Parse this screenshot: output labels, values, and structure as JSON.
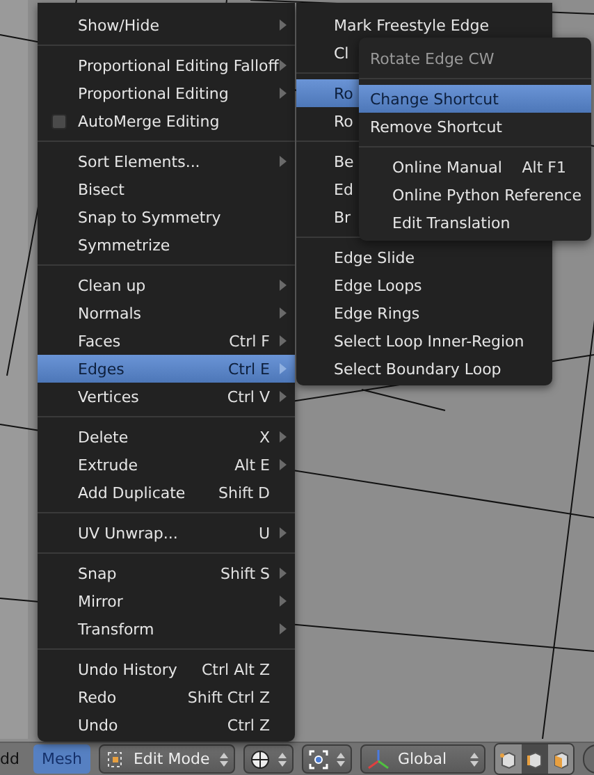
{
  "main_menu": {
    "items": [
      {
        "kind": "submenu",
        "label": "Show/Hide",
        "selected": false
      },
      {
        "kind": "separator"
      },
      {
        "kind": "submenu",
        "label": "Proportional Editing Falloff",
        "selected": false
      },
      {
        "kind": "submenu",
        "label": "Proportional Editing",
        "selected": false
      },
      {
        "kind": "checkbox",
        "label": "AutoMerge Editing",
        "checked": false,
        "selected": false
      },
      {
        "kind": "separator"
      },
      {
        "kind": "submenu",
        "label": "Sort Elements...",
        "selected": false
      },
      {
        "kind": "action",
        "label": "Bisect",
        "selected": false
      },
      {
        "kind": "action",
        "label": "Snap to Symmetry",
        "selected": false
      },
      {
        "kind": "action",
        "label": "Symmetrize",
        "selected": false
      },
      {
        "kind": "separator"
      },
      {
        "kind": "submenu",
        "label": "Clean up",
        "selected": false
      },
      {
        "kind": "submenu",
        "label": "Normals",
        "selected": false
      },
      {
        "kind": "submenu",
        "label": "Faces",
        "shortcut": "Ctrl F",
        "selected": false
      },
      {
        "kind": "submenu",
        "label": "Edges",
        "shortcut": "Ctrl E",
        "selected": true
      },
      {
        "kind": "submenu",
        "label": "Vertices",
        "shortcut": "Ctrl V",
        "selected": false
      },
      {
        "kind": "separator"
      },
      {
        "kind": "submenu",
        "label": "Delete",
        "shortcut": "X",
        "selected": false
      },
      {
        "kind": "submenu",
        "label": "Extrude",
        "shortcut": "Alt E",
        "selected": false
      },
      {
        "kind": "action",
        "label": "Add Duplicate",
        "shortcut": "Shift D",
        "selected": false
      },
      {
        "kind": "separator"
      },
      {
        "kind": "submenu",
        "label": "UV Unwrap...",
        "shortcut": "U",
        "selected": false
      },
      {
        "kind": "separator"
      },
      {
        "kind": "submenu",
        "label": "Snap",
        "shortcut": "Shift S",
        "selected": false
      },
      {
        "kind": "submenu",
        "label": "Mirror",
        "selected": false
      },
      {
        "kind": "submenu",
        "label": "Transform",
        "selected": false
      },
      {
        "kind": "separator"
      },
      {
        "kind": "action",
        "label": "Undo History",
        "shortcut": "Ctrl Alt Z",
        "selected": false
      },
      {
        "kind": "action",
        "label": "Redo",
        "shortcut": "Shift Ctrl Z",
        "selected": false
      },
      {
        "kind": "action",
        "label": "Undo",
        "shortcut": "Ctrl Z",
        "selected": false
      }
    ]
  },
  "edges_menu": {
    "items": [
      {
        "kind": "action",
        "label": "Mark Freestyle Edge",
        "selected": false
      },
      {
        "kind": "action",
        "label": "Cl",
        "selected": false
      },
      {
        "kind": "separator"
      },
      {
        "kind": "action",
        "label": "Ro",
        "selected": true
      },
      {
        "kind": "action",
        "label": "Ro",
        "selected": false
      },
      {
        "kind": "separator"
      },
      {
        "kind": "action",
        "label": "Be",
        "selected": false
      },
      {
        "kind": "action",
        "label": "Ed",
        "selected": false
      },
      {
        "kind": "action",
        "label": "Br",
        "selected": false
      },
      {
        "kind": "separator"
      },
      {
        "kind": "action",
        "label": "Edge Slide",
        "selected": false
      },
      {
        "kind": "action",
        "label": "Edge Loops",
        "selected": false
      },
      {
        "kind": "action",
        "label": "Edge Rings",
        "selected": false
      },
      {
        "kind": "action",
        "label": "Select Loop Inner-Region",
        "selected": false
      },
      {
        "kind": "action",
        "label": "Select Boundary Loop",
        "selected": false
      }
    ]
  },
  "context_popup": {
    "title": "Rotate Edge CW",
    "items": [
      {
        "kind": "separator"
      },
      {
        "kind": "action",
        "label": "Change Shortcut",
        "selected": true
      },
      {
        "kind": "action",
        "label": "Remove Shortcut",
        "selected": false
      },
      {
        "kind": "separator"
      },
      {
        "kind": "link",
        "label": "Online Manual",
        "shortcut": "Alt F1",
        "selected": false
      },
      {
        "kind": "link",
        "label": "Online Python Reference",
        "selected": false
      },
      {
        "kind": "link",
        "label": "Edit Translation",
        "selected": false
      }
    ]
  },
  "header": {
    "items": [
      {
        "kind": "menu",
        "label": "dd",
        "selected": false
      },
      {
        "kind": "menu",
        "label": "Mesh",
        "selected": true
      },
      {
        "kind": "dropdown",
        "label": "Edit Mode"
      },
      {
        "kind": "dropdown"
      },
      {
        "kind": "dropdown"
      },
      {
        "kind": "dropdown",
        "label": "Global"
      },
      {
        "kind": "selectmodes",
        "modes": [
          {
            "selected": false
          },
          {
            "selected": true
          },
          {
            "selected": false
          }
        ]
      },
      {
        "kind": "round"
      }
    ]
  }
}
